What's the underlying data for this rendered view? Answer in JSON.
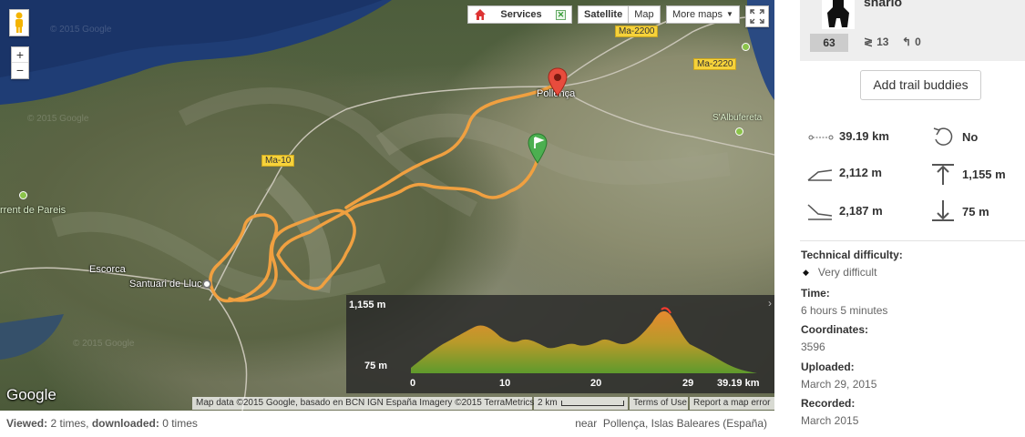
{
  "map": {
    "services_label": "Services",
    "satellite_label": "Satellite",
    "map_label": "Map",
    "more_maps_label": "More maps",
    "zoom_in": "+",
    "zoom_out": "−",
    "watermarks": [
      "© 2015 Google",
      "© 2015 Google",
      "© 2015 Google"
    ],
    "place_labels": {
      "pollenca": "Pollença",
      "albufereta": "S'Albufereta",
      "escorca": "Escorca",
      "santuari": "Santuari de Lluc",
      "torrent": "rrent de Pareis"
    },
    "roads": [
      "Ma-2200",
      "Ma-2220",
      "Ma-10"
    ],
    "google_logo": "Google",
    "attribution": "Map data ©2015 Google, basado en BCN IGN España Imagery ©2015 TerraMetrics",
    "scale_label": "2 km",
    "terms": "Terms of Use",
    "report": "Report a map error"
  },
  "elevation": {
    "max_label": "1,155 m",
    "min_label": "75 m",
    "x_ticks": [
      "0",
      "10",
      "20",
      "29"
    ],
    "total": "39.19 km"
  },
  "footer": {
    "viewed_label": "Viewed:",
    "viewed_value": "2 times,",
    "downloaded_label": "downloaded:",
    "downloaded_value": "0 times",
    "near_label": "near",
    "location": "Pollença, Islas Baleares (España)"
  },
  "sidebar": {
    "username": "snario",
    "trails_count": "63",
    "followers": "13",
    "following": "0",
    "add_buddies": "Add trail buddies",
    "distance": "39.19 km",
    "loop": "No",
    "elev_gain": "2,112 m",
    "max_elev": "1,155 m",
    "elev_loss": "2,187 m",
    "min_elev": "75 m",
    "tech_label": "Technical difficulty:",
    "tech_value": "Very difficult",
    "time_label": "Time:",
    "time_value": "6 hours 5 minutes",
    "coord_label": "Coordinates:",
    "coord_value": "3596",
    "uploaded_label": "Uploaded:",
    "uploaded_value": "March 29, 2015",
    "recorded_label": "Recorded:",
    "recorded_value": "March 2015"
  },
  "colors": {
    "track": "#f0a040",
    "start_pin": "#4caf50",
    "end_pin": "#e84c3d"
  }
}
